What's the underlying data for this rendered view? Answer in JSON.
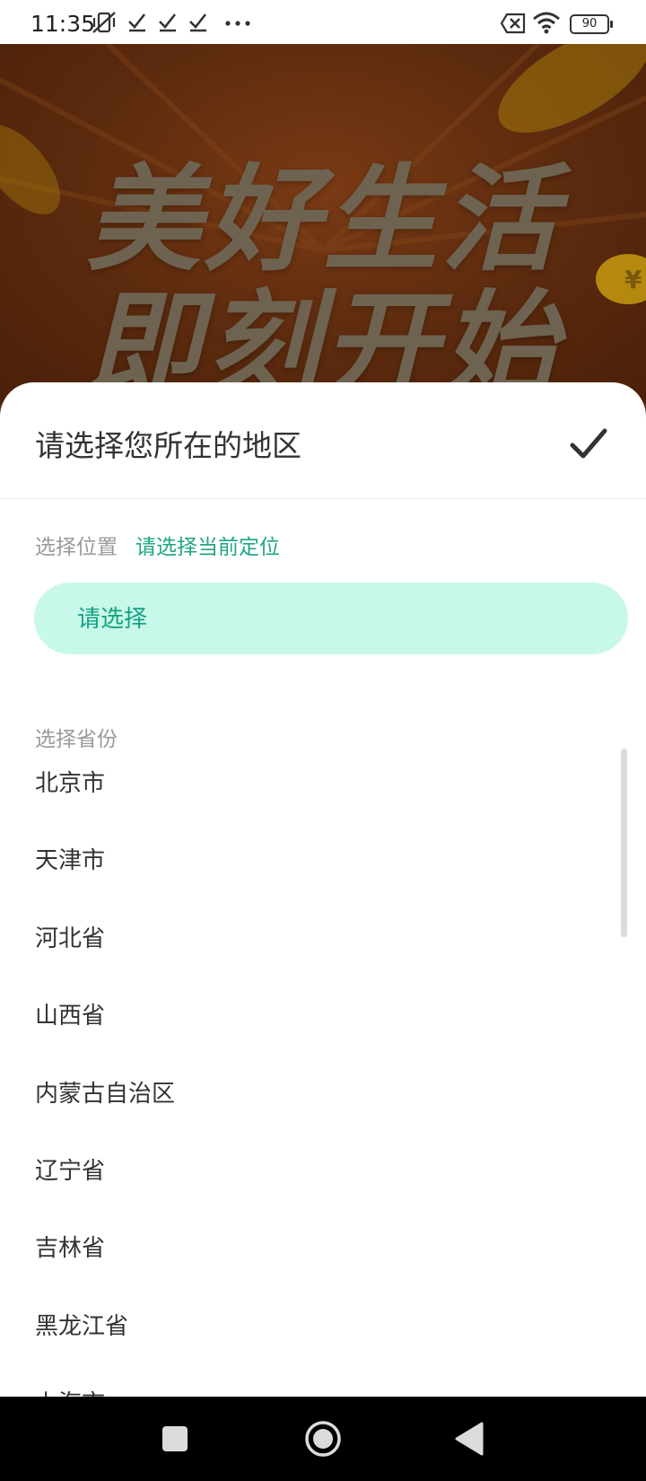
{
  "status_bar": {
    "time": "11:35",
    "battery": "90",
    "icons": [
      "vibrate-off-icon",
      "check-icon",
      "check-icon",
      "check-icon",
      "more-dots-icon",
      "sim-blocked-icon",
      "wifi-icon",
      "battery-icon"
    ]
  },
  "banner": {
    "line1": "美好生活",
    "line2": "即刻开始"
  },
  "sheet": {
    "title": "请选择您所在的地区",
    "confirm_icon": "check-icon",
    "location_label": "选择位置",
    "location_link": "请选择当前定位",
    "select_placeholder": "请选择",
    "province_label": "选择省份",
    "provinces": [
      "北京市",
      "天津市",
      "河北省",
      "山西省",
      "内蒙古自治区",
      "辽宁省",
      "吉林省",
      "黑龙江省",
      "上海市"
    ]
  },
  "nav_bar": {
    "icons": [
      "recent-apps-icon",
      "home-icon",
      "back-icon"
    ]
  },
  "colors": {
    "accent": "#1fa585",
    "pill_bg": "#c8f8ea",
    "banner_bg": "#5b2a0e"
  }
}
